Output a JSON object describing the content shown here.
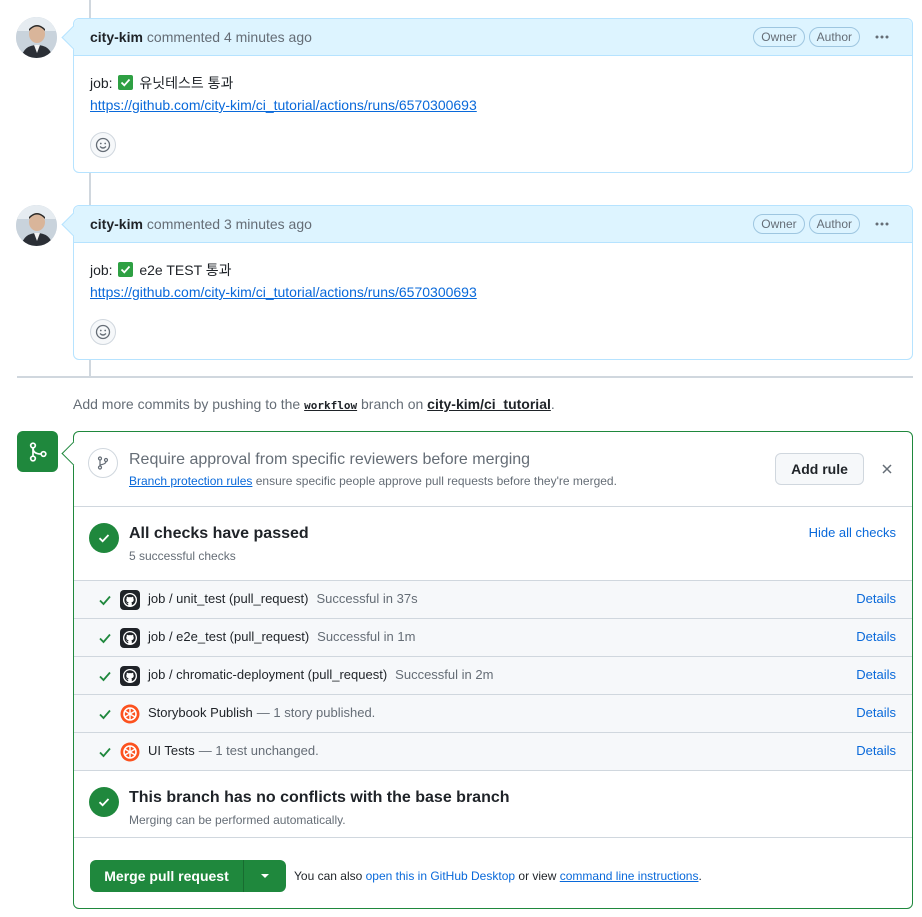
{
  "comments": [
    {
      "author": "city-kim",
      "meta": "commented 4 minutes ago",
      "badges": [
        "Owner",
        "Author"
      ],
      "body_prefix": "job:",
      "body_text": "유닛테스트 통과",
      "link": "https://github.com/city-kim/ci_tutorial/actions/runs/6570300693"
    },
    {
      "author": "city-kim",
      "meta": "commented 3 minutes ago",
      "badges": [
        "Owner",
        "Author"
      ],
      "body_prefix": "job:",
      "body_text": "e2e TEST 통과",
      "link": "https://github.com/city-kim/ci_tutorial/actions/runs/6570300693"
    }
  ],
  "push_note": {
    "prefix": "Add more commits by pushing to the",
    "branch": "workflow",
    "middle": "branch on",
    "repo": "city-kim/ci_tutorial",
    "suffix": "."
  },
  "approval": {
    "title": "Require approval from specific reviewers before merging",
    "link": "Branch protection rules",
    "text": "ensure specific people approve pull requests before they're merged.",
    "button": "Add rule"
  },
  "checks_summary": {
    "title": "All checks have passed",
    "subtitle": "5 successful checks",
    "toggle": "Hide all checks"
  },
  "checks": [
    {
      "name": "job / unit_test (pull_request)",
      "desc": "Successful in 37s",
      "app": "github-icon",
      "details": "Details"
    },
    {
      "name": "job / e2e_test (pull_request)",
      "desc": "Successful in 1m",
      "app": "github-icon",
      "details": "Details"
    },
    {
      "name": "job / chromatic-deployment (pull_request)",
      "desc": "Successful in 2m",
      "app": "github-icon",
      "details": "Details"
    },
    {
      "name": "Storybook Publish",
      "desc": "— 1 story published.",
      "app": "chromatic-icon",
      "details": "Details"
    },
    {
      "name": "UI Tests",
      "desc": "— 1 test unchanged.",
      "app": "chromatic-icon",
      "details": "Details"
    }
  ],
  "conflicts": {
    "title": "This branch has no conflicts with the base branch",
    "subtitle": "Merging can be performed automatically."
  },
  "merge": {
    "button": "Merge pull request",
    "note_prefix": "You can also",
    "desktop_link": "open this in GitHub Desktop",
    "note_middle": "or view",
    "cli_link": "command line instructions",
    "note_suffix": "."
  },
  "colors": {
    "success": "#1f883d",
    "link": "#0969da",
    "header_bg": "#ddf4ff"
  }
}
